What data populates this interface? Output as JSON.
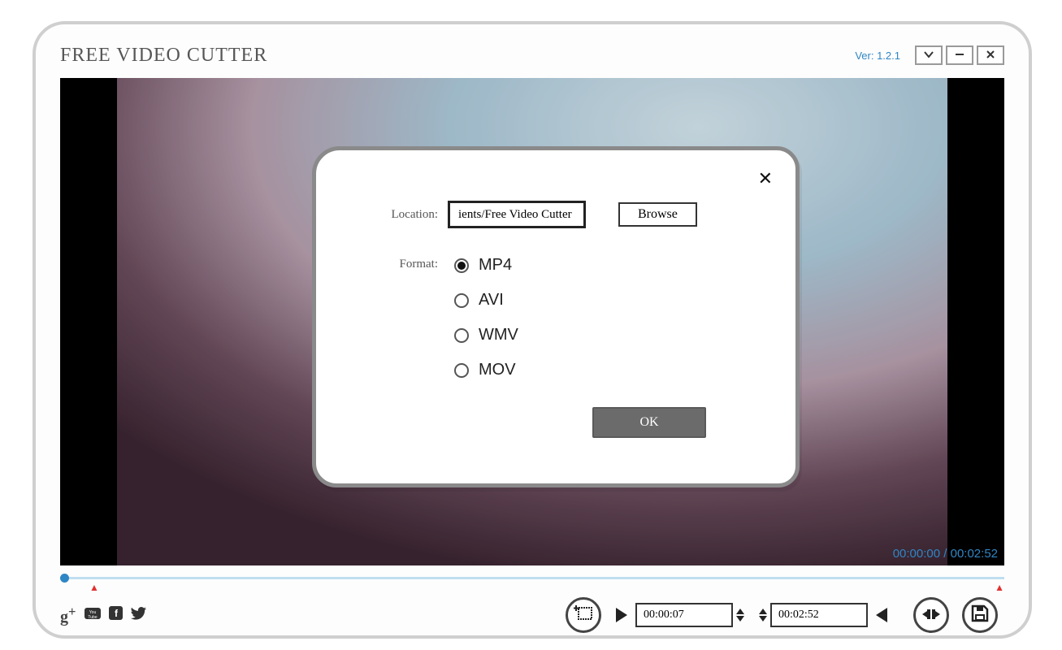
{
  "app": {
    "title": "FREE VIDEO CUTTER",
    "version": "Ver: 1.2.1"
  },
  "player": {
    "time_current": "00:00:00",
    "time_total": "00:02:52",
    "clip_start": "00:00:07",
    "clip_end": "00:02:52"
  },
  "dialog": {
    "location_label": "Location:",
    "location_value": "ients/Free Video Cutter",
    "browse_label": "Browse",
    "format_label": "Format:",
    "formats": {
      "a": "MP4",
      "b": "AVI",
      "c": "WMV",
      "d": "MOV"
    },
    "selected_format": "MP4",
    "ok_label": "OK"
  },
  "icons": {
    "gplus": "g⁺",
    "youtube": "▶",
    "fb": "f",
    "tw": "t"
  }
}
